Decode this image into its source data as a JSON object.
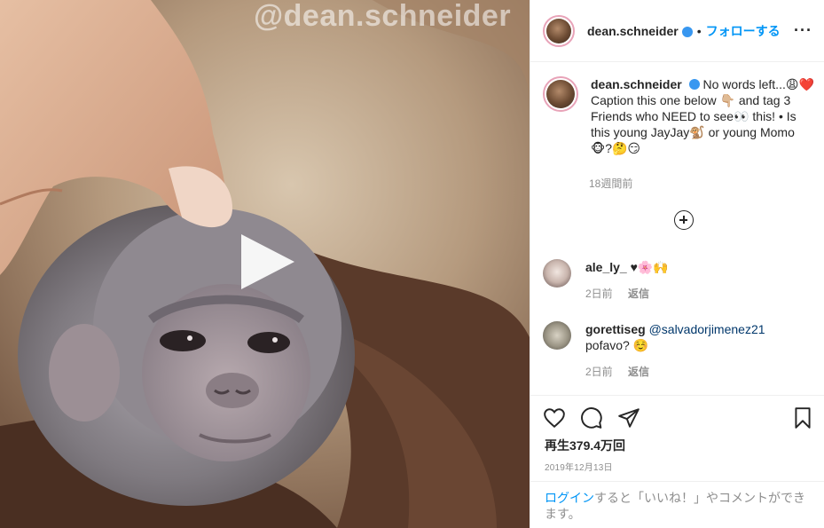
{
  "media": {
    "watermark": "@dean.schneider",
    "play_icon": "play-icon"
  },
  "header": {
    "username": "dean.schneider",
    "separator": "•",
    "follow_label": "フォローする",
    "more_icon": "more-options-icon",
    "more_label": "···"
  },
  "caption": {
    "username": "dean.schneider",
    "text": "No words left...😩❤️ Caption this one below 👇🏼 and tag 3 Friends who NEED to see👀 this! • Is this young JayJay🐒 or young Momo 🐵?🤔😏",
    "time": "18週間前"
  },
  "comments": [
    {
      "username": "ale_ly_",
      "text": "♥🌸🙌",
      "time": "2日前",
      "reply": "返信"
    },
    {
      "username": "gorettiseg",
      "mention": "@salvadorjimenez21",
      "text": "pofavo? ☺️",
      "time": "2日前",
      "reply": "返信"
    }
  ],
  "stats": {
    "views": "再生379.4万回",
    "date": "2019年12月13日"
  },
  "login_prompt": {
    "link": "ログイン",
    "text": "すると「いいね！」やコメントができます。"
  },
  "colors": {
    "accent": "#0095f6",
    "verified": "#3897f0",
    "muted": "#8e8e8e",
    "text": "#262626"
  }
}
